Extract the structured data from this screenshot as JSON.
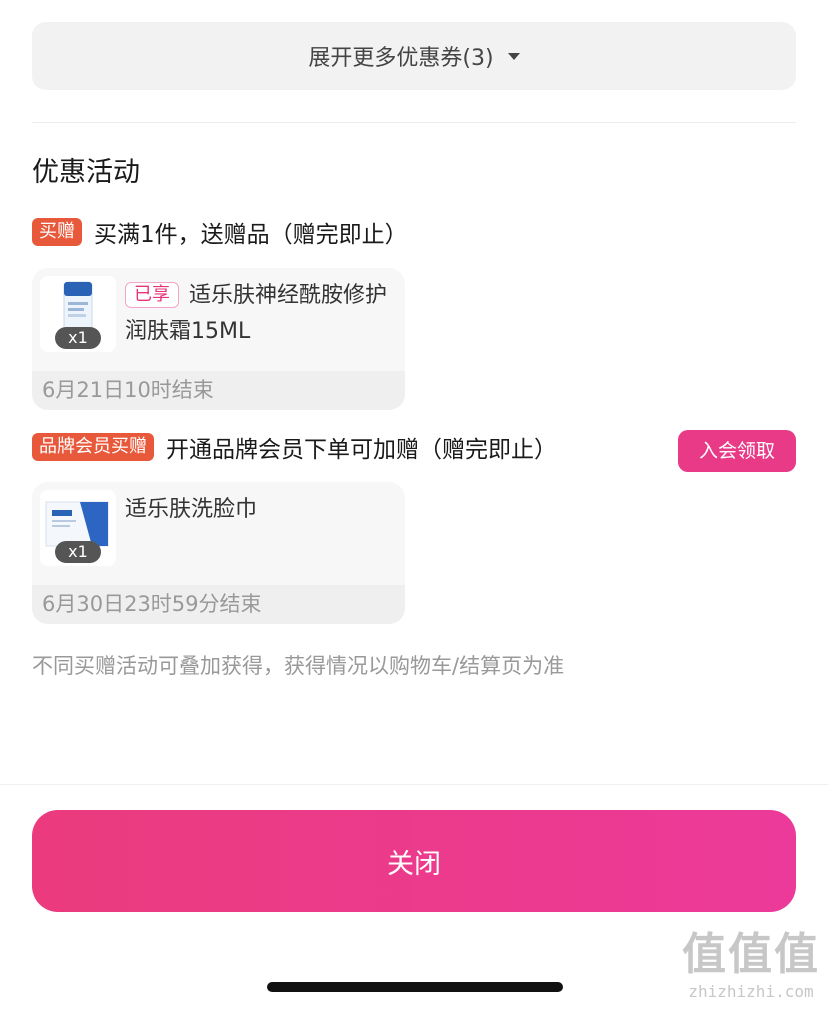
{
  "coupons": {
    "expand_label": "展开更多优惠券(3)"
  },
  "section": {
    "title": "优惠活动"
  },
  "promotions": [
    {
      "tag": "买赠",
      "text": "买满1件，送赠品（赠完即止）",
      "gift": {
        "enjoyed_badge": "已享",
        "name": "适乐肤神经酰胺修护润肤霜15ML",
        "qty": "x1",
        "end_time": "6月21日10时结束"
      }
    },
    {
      "tag": "品牌会员买赠",
      "text": "开通品牌会员下单可加赠（赠完即止）",
      "action_label": "入会领取",
      "gift": {
        "name": "适乐肤洗脸巾",
        "qty": "x1",
        "end_time": "6月30日23时59分结束"
      }
    }
  ],
  "note": "不同买赠活动可叠加获得，获得情况以购物车/结算页为准",
  "close_label": "关闭",
  "watermark": {
    "logo": "值值值",
    "site": "zhizhizhi.com"
  },
  "colors": {
    "accent": "#e83a86",
    "tag_bg": "#e8593b",
    "close_gradient_start": "#eb3b7d",
    "close_gradient_end": "#ec3a9a"
  }
}
